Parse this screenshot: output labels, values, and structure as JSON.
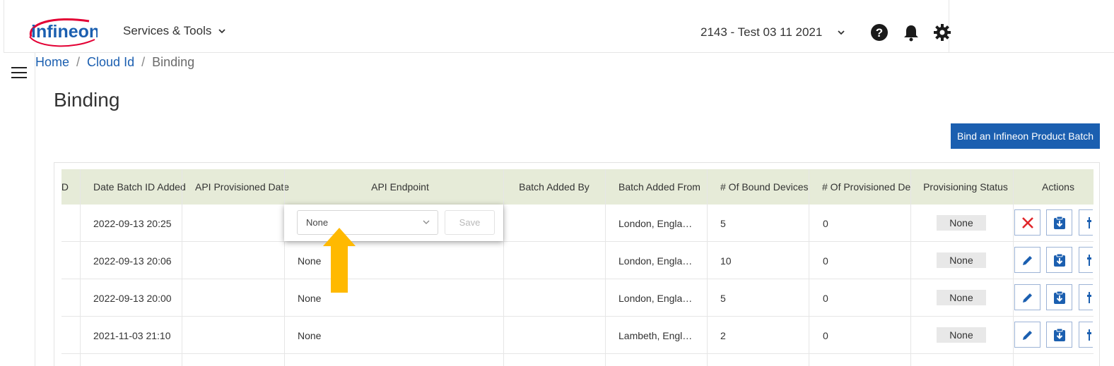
{
  "header": {
    "logo_text": "infineon",
    "services_label": "Services & Tools",
    "org_label": "2143 - Test 03 11 2021",
    "icons": [
      "help-icon",
      "bell-icon",
      "gear-icon"
    ]
  },
  "breadcrumb": {
    "home": "Home",
    "sep": "/",
    "cloud": "Cloud Id",
    "current": "Binding"
  },
  "page_title": "Binding",
  "bind_button_label": "Bind an Infineon Product Batch",
  "table": {
    "columns": {
      "id_fragment": "D",
      "date": "Date Batch ID Added",
      "api_date": "API Provisioned Date",
      "endpoint": "API Endpoint",
      "added_by": "Batch Added By",
      "added_from": "Batch Added From",
      "bound": "# Of Bound Devices",
      "provisioned": "# Of Provisioned Dev",
      "status": "Provisioning Status",
      "actions": "Actions"
    },
    "rows": [
      {
        "date": "2022-09-13 20:25",
        "endpoint": "",
        "from": "London, Engla…",
        "bound": "5",
        "prov": "0",
        "status": "None"
      },
      {
        "date": "2022-09-13 20:06",
        "endpoint": "None",
        "from": "London, Engla…",
        "bound": "10",
        "prov": "0",
        "status": "None"
      },
      {
        "date": "2022-09-13 20:00",
        "endpoint": "None",
        "from": "London, Engla…",
        "bound": "5",
        "prov": "0",
        "status": "None"
      },
      {
        "date": "2021-11-03 21:10",
        "endpoint": "None",
        "from": "Lambeth, Engl…",
        "bound": "2",
        "prov": "0",
        "status": "None"
      }
    ]
  },
  "popover": {
    "select_value": "None",
    "save_label": "Save"
  },
  "colors": {
    "primary": "#1b5fb0",
    "header_row": "#e6ebd8",
    "arrow": "#ffb900",
    "delete": "#e0262a"
  }
}
